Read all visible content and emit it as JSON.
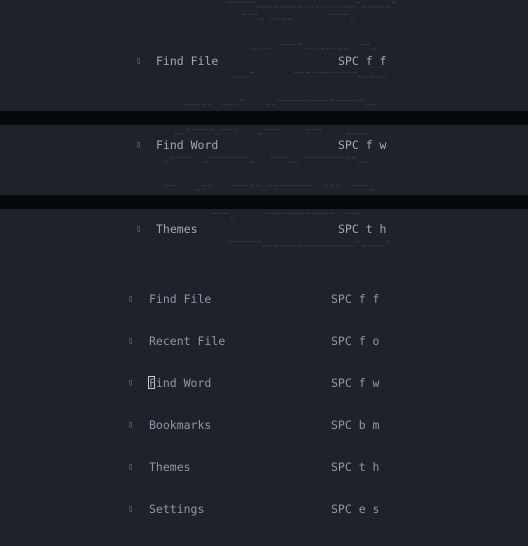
{
  "ghost_menu": [
    {
      "icon": "file-icon",
      "label": "Find File",
      "key": "SPC f f"
    },
    {
      "icon": "search-icon",
      "label": "Find Word",
      "key": "SPC f w"
    },
    {
      "icon": "palette-icon",
      "label": "Themes",
      "key": "SPC t h"
    }
  ],
  "menu": [
    {
      "icon": "file-icon",
      "label": "Find File",
      "key": "SPC f f"
    },
    {
      "icon": "history-icon",
      "label": "Recent File",
      "key": "SPC f o"
    },
    {
      "icon": "search-icon",
      "label": "Find Word",
      "key": "SPC f w"
    },
    {
      "icon": "bookmark-icon",
      "label": "Bookmarks",
      "key": "SPC b m"
    },
    {
      "icon": "palette-icon",
      "label": "Themes",
      "key": "SPC t h"
    },
    {
      "icon": "gear-icon",
      "label": "Settings",
      "key": "SPC e s"
    }
  ],
  "colors": {
    "background": "#1e222a",
    "text": "#8f98aa",
    "ascii": "#3f4552"
  }
}
